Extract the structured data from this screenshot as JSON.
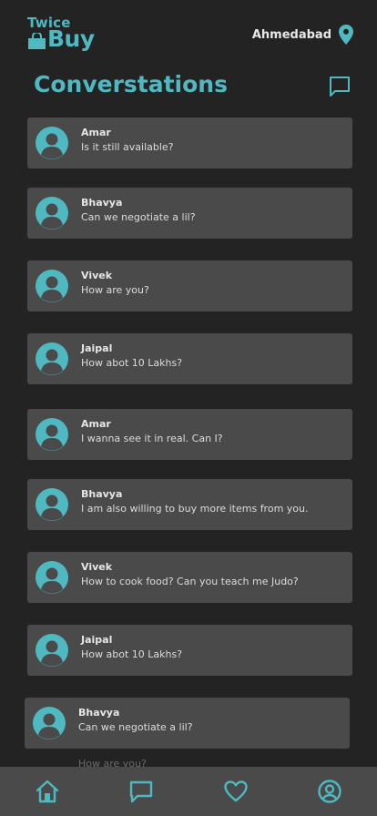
{
  "app": {
    "logo_top": "Twice",
    "logo_bottom": "Buy"
  },
  "header": {
    "location": "Ahmedabad",
    "location_icon": "map-pin-icon"
  },
  "page": {
    "title": "Converstations",
    "new_chat_icon": "message-square-icon"
  },
  "conversations": [
    {
      "name": "Amar",
      "message": "Is it still available?"
    },
    {
      "name": "Bhavya",
      "message": "Can we negotiate a lil?"
    },
    {
      "name": "Vivek",
      "message": "How are you?"
    },
    {
      "name": "Jaipal",
      "message": "How abot 10 Lakhs?"
    },
    {
      "name": "Amar",
      "message": "I wanna see it in real. Can I?"
    },
    {
      "name": "Bhavya",
      "message": "I am also willing to buy more items from you."
    },
    {
      "name": "Vivek",
      "message": "How to cook food? Can you teach me Judo?"
    },
    {
      "name": "Jaipal",
      "message": "How abot 10 Lakhs?"
    },
    {
      "name": "Bhavya",
      "message": "Can we negotiate a lil?"
    }
  ],
  "partially_hidden_text": "How are you?",
  "nav": [
    "home-icon",
    "chat-icon",
    "heart-icon",
    "profile-icon"
  ],
  "colors": {
    "accent": "#4fb8c0",
    "background": "#232323",
    "card": "#4a4a4a",
    "text": "#e6e6e6"
  }
}
